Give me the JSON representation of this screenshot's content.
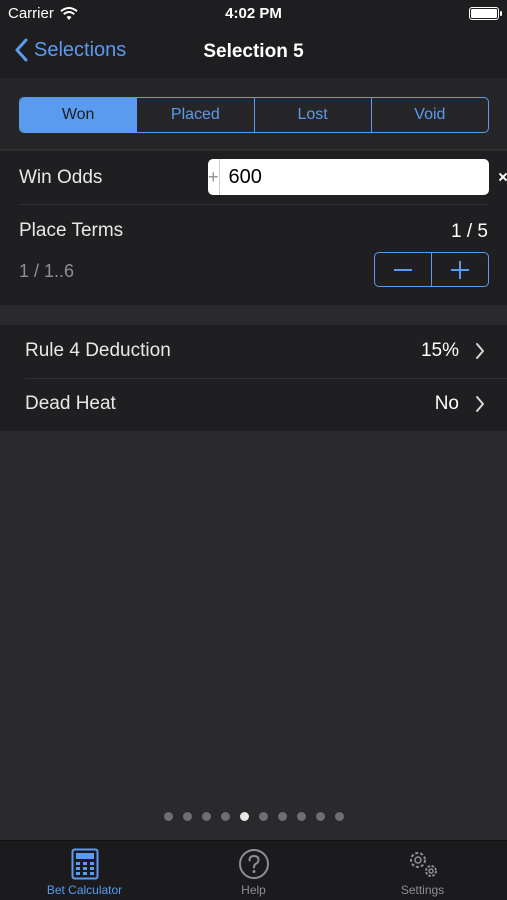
{
  "status": {
    "carrier": "Carrier",
    "time": "4:02 PM"
  },
  "nav": {
    "back_label": "Selections",
    "title": "Selection 5"
  },
  "segments": [
    "Won",
    "Placed",
    "Lost",
    "Void"
  ],
  "selected_segment": "Won",
  "win_odds": {
    "label": "Win Odds",
    "prefix": "+",
    "value": "600"
  },
  "place_terms": {
    "label": "Place Terms",
    "value": "1 / 5",
    "sub": "1 / 1..6"
  },
  "details": {
    "rule4": {
      "label": "Rule 4 Deduction",
      "value": "15%"
    },
    "dead_heat": {
      "label": "Dead Heat",
      "value": "No"
    }
  },
  "page_dots": {
    "count": 10,
    "active": 5
  },
  "tabs": [
    {
      "label": "Bet Calculator",
      "icon": "calculator-icon",
      "active": true
    },
    {
      "label": "Help",
      "icon": "help-icon",
      "active": false
    },
    {
      "label": "Settings",
      "icon": "gears-icon",
      "active": false
    }
  ],
  "colors": {
    "accent": "#5b9bef",
    "background": "#2a2a2c",
    "panel": "#1f1f21"
  }
}
